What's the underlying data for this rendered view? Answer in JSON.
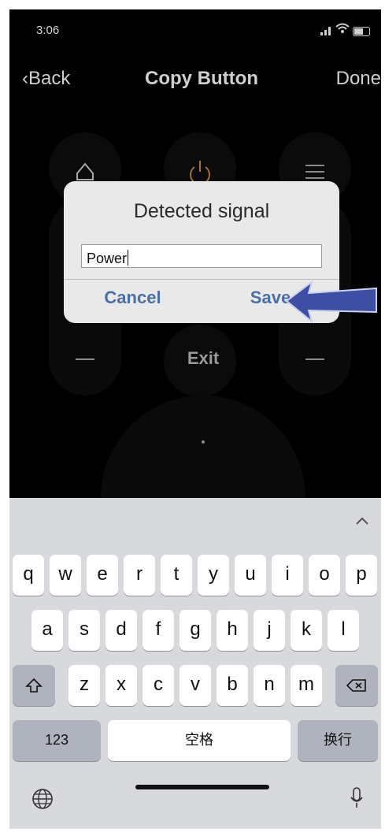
{
  "status_bar": {
    "time": "3:06"
  },
  "nav": {
    "back": "Back",
    "title": "Copy Button",
    "done": "Done"
  },
  "remote": {
    "exit": "Exit"
  },
  "dialog": {
    "title": "Detected signal",
    "input_value": "Power",
    "cancel": "Cancel",
    "save": "Save"
  },
  "keyboard": {
    "row1": [
      "q",
      "w",
      "e",
      "r",
      "t",
      "y",
      "u",
      "i",
      "o",
      "p"
    ],
    "row2": [
      "a",
      "s",
      "d",
      "f",
      "g",
      "h",
      "j",
      "k",
      "l"
    ],
    "row3": [
      "z",
      "x",
      "c",
      "v",
      "b",
      "n",
      "m"
    ],
    "numbers_key": "123",
    "space_key": "空格",
    "return_key": "换行"
  },
  "colors": {
    "dialog_button": "#4a6fa5",
    "arrow": "#3f4ea5"
  }
}
